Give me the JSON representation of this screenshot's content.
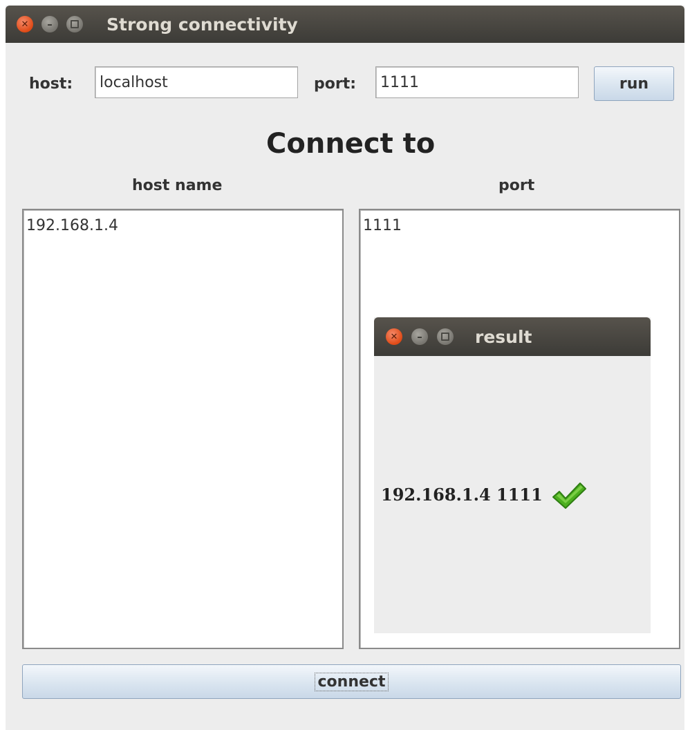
{
  "window": {
    "title": "Strong connectivity"
  },
  "form": {
    "host_label": "host:",
    "host_value": "localhost",
    "port_label": "port:",
    "port_value": "1111",
    "run_label": "run"
  },
  "main": {
    "heading": "Connect to",
    "host_column_label": "host name",
    "port_column_label": "port",
    "host_items": [
      "192.168.1.4"
    ],
    "port_items": [
      "1111"
    ],
    "connect_label": "connect"
  },
  "dialog": {
    "title": "result",
    "message": "192.168.1.4 1111",
    "status_icon": "checkmark-icon",
    "status_color": "#4caf1f"
  },
  "colors": {
    "titlebar": "#3c3b37",
    "close_button": "#df4a16",
    "window_bg": "#ededed"
  }
}
